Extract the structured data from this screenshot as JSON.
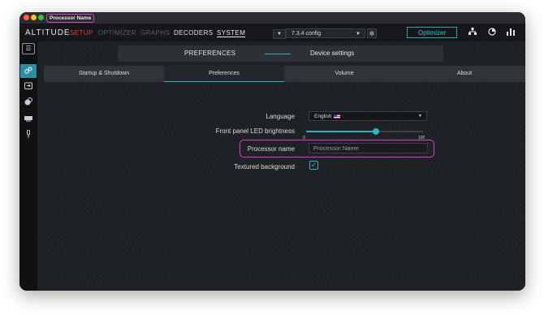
{
  "window": {
    "title": "Processor Name"
  },
  "menubar": {
    "logo": "ALTITUDE",
    "tabs": {
      "setup": "SETUP",
      "optimizer": "OPTIMIZER",
      "graphs": "GRAPHS",
      "decoders": "DECODERS",
      "system": "SYSTEM"
    },
    "config_select": "7.3.4 config",
    "optimizer_button": "Optimizer",
    "icons": [
      "network-icon",
      "timer-icon",
      "equalizer-icon"
    ]
  },
  "sidebar": {
    "items": [
      "menu-icon",
      "speakers-icon",
      "input-icon",
      "audio-icon",
      "display-icon",
      "microphone-icon"
    ]
  },
  "segment": {
    "left": "PREFERENCES",
    "right": "Device settings"
  },
  "tabs": [
    "Startup & Shutdown",
    "Preferences",
    "Volume",
    "About"
  ],
  "prefs": {
    "language_label": "Language",
    "language_value": "English",
    "brightness_label": "Front panel LED brightness",
    "brightness_min": "0",
    "brightness_max": "100",
    "brightness_value": 60,
    "processor_name_label": "Processor name",
    "processor_name_placeholder": "Processor Name",
    "textured_label": "Textured background",
    "textured_checked": true
  },
  "colors": {
    "accent": "#2fb3c0",
    "highlight": "#d63fd6",
    "setup_red": "#e0403a"
  }
}
